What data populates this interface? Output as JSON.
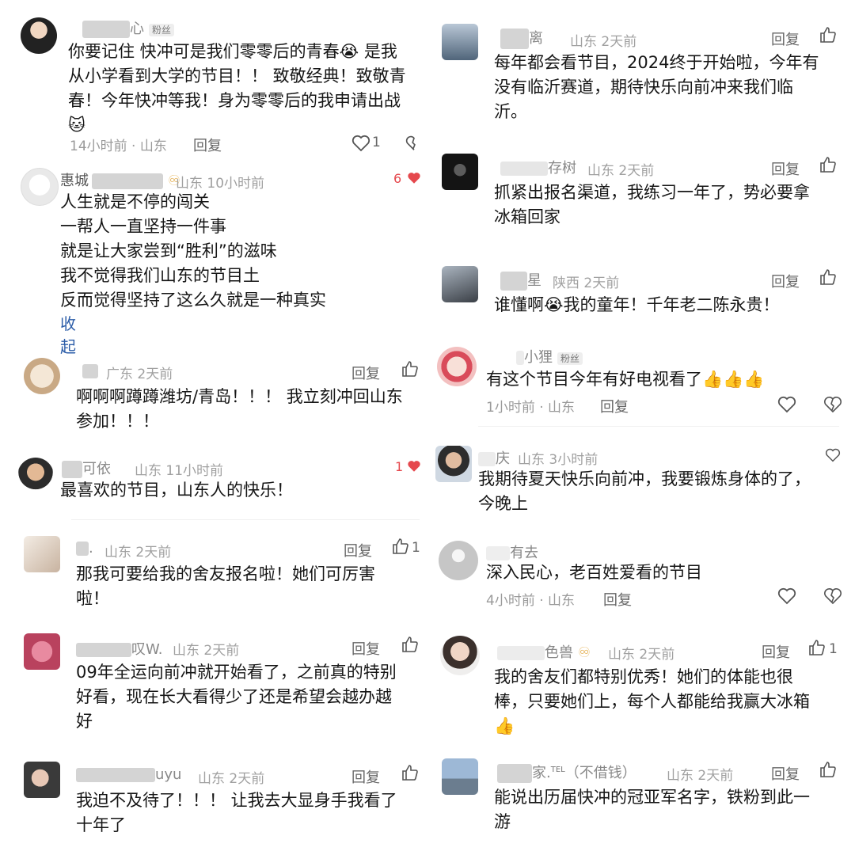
{
  "left": [
    {
      "name_suffix": "心",
      "badge": "粉丝",
      "lines": [
        "你要记住 快冲可是我们零零后的青春😭 是我",
        "从小学看到大学的节目！！ 致敬经典！致敬青",
        "春！今年快冲等我！身为零零后的我申请出战",
        "🐱"
      ],
      "meta": "14小时前 · 山东",
      "reply": "回复",
      "like_count": "1"
    },
    {
      "name": "惠城",
      "name_suffix": "",
      "loc": "山东 10小时前",
      "heart_count": "6",
      "lines": [
        "人生就是不停的闯关",
        "一帮人一直坚持一件事",
        "就是让大家尝到“胜利”的滋味",
        "我不觉得我们山东的节目土",
        "反而觉得坚持了这么久就是一种真实"
      ],
      "collapse": "收起"
    },
    {
      "loc": "广东  2天前",
      "reply": "回复",
      "lines": [
        "啊啊啊蹲蹲潍坊/青岛！！！ 我立刻冲回山东",
        "参加！！！"
      ]
    },
    {
      "name_suffix": "可依",
      "loc": "山东 11小时前",
      "heart_count": "1",
      "lines": [
        "最喜欢的节目，山东人的快乐！"
      ]
    },
    {
      "name_suffix": ".",
      "loc": "山东  2天前",
      "reply": "回复",
      "like_count": "1",
      "lines": [
        "那我可要给我的舍友报名啦！她们可厉害",
        "啦！"
      ]
    },
    {
      "name_suffix": "叹W.",
      "loc": "山东  2天前",
      "reply": "回复",
      "lines": [
        "09年全运向前冲就开始看了，之前真的特别",
        "好看，现在长大看得少了还是希望会越办越",
        "好"
      ]
    },
    {
      "name_suffix": "uyu",
      "loc": "山东  2天前",
      "reply": "回复",
      "lines": [
        "我迫不及待了！！！ 让我去大显身手我看了",
        "十年了"
      ]
    }
  ],
  "right": [
    {
      "name_suffix": "离",
      "loc": "山东  2天前",
      "reply": "回复",
      "lines": [
        "每年都会看节目，2024终于开始啦，今年有",
        "没有临沂赛道，期待快乐向前冲来我们临",
        "沂。"
      ]
    },
    {
      "name_suffix": "存树",
      "loc": "山东  2天前",
      "reply": "回复",
      "lines": [
        "抓紧出报名渠道，我练习一年了，势必要拿",
        "冰箱回家"
      ]
    },
    {
      "name_suffix": "星",
      "loc": "陕西  2天前",
      "reply": "回复",
      "lines": [
        "谁懂啊😭我的童年！千年老二陈永贵！"
      ]
    },
    {
      "name_suffix": "小狸",
      "badge": "粉丝",
      "lines": [
        "有这个节目今年有好电视看了👍👍👍"
      ],
      "meta": "1小时前 · 山东",
      "reply": "回复"
    },
    {
      "name_suffix": "庆",
      "loc": "山东  3小时前",
      "lines": [
        "我期待夏天快乐向前冲，我要锻炼身体的了，",
        "今晚上"
      ]
    },
    {
      "name_suffix": "有去",
      "lines": [
        "深入民心，老百姓爱看的节目"
      ],
      "meta": "4小时前 · 山东",
      "reply": "回复"
    },
    {
      "name_suffix": "色兽",
      "loc": "山东  2天前",
      "reply": "回复",
      "like_count": "1",
      "lines": [
        "我的舍友们都特别优秀！她们的体能也很",
        "棒，只要她们上，每个人都能给我赢大冰箱",
        "👍"
      ]
    },
    {
      "name_suffix": "家.",
      "name_tel": "TEL",
      "name_extra": "（不借钱）",
      "loc": "山东  2天前",
      "reply": "回复",
      "lines": [
        "能说出历届快冲的冠亚军名字，铁粉到此一",
        "游"
      ]
    }
  ]
}
